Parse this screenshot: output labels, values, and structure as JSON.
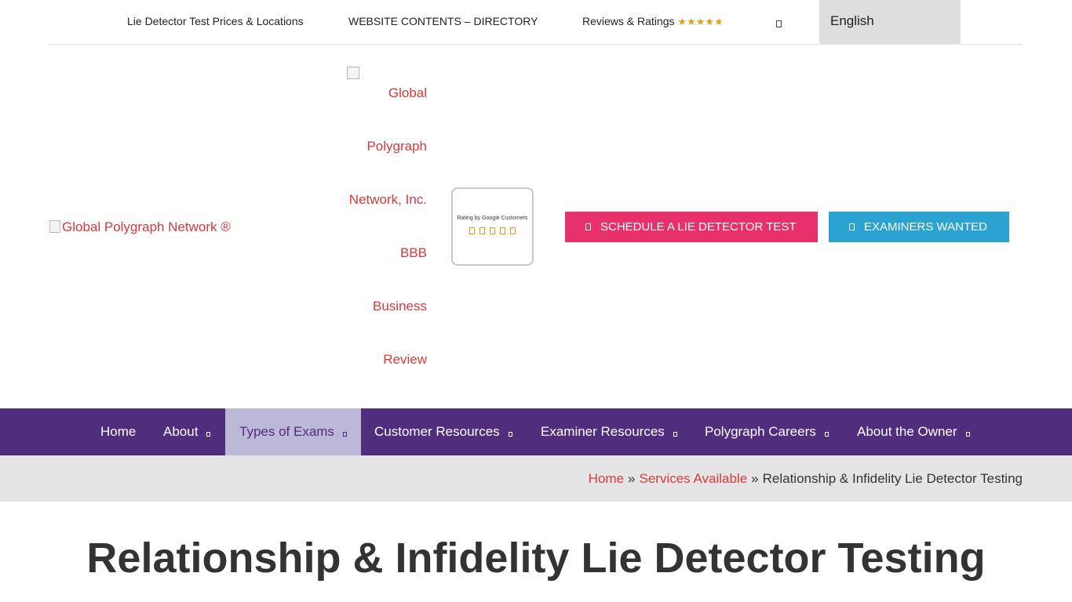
{
  "topbar": {
    "link_prices": "Lie Detector Test Prices & Locations",
    "link_directory": "WEBSITE CONTENTS – DIRECTORY",
    "link_reviews": "Reviews & Ratings",
    "reviews_stars": "★★★★★",
    "icon": "search-icon",
    "language": "English"
  },
  "header": {
    "logo_alt": "Global Polygraph Network ®",
    "bbb_lines": [
      "Global",
      "Polygraph",
      "Network, Inc.",
      "BBB",
      "Business",
      "Review"
    ],
    "rating_badge_text": "Rating by Google Customers",
    "rating_stars": 5,
    "schedule_button": "SCHEDULE A LIE DETECTOR TEST",
    "examiners_button": "EXAMINERS WANTED",
    "schedule_color": "#e8316a",
    "examiners_color": "#2aa3d3"
  },
  "nav": {
    "background": "#512d7d",
    "items": [
      {
        "label": "Home"
      },
      {
        "label": "About"
      },
      {
        "label": "Types of Exams"
      },
      {
        "label": "Customer Resources"
      },
      {
        "label": "Examiner Resources"
      },
      {
        "label": "Polygraph Careers"
      },
      {
        "label": "About the Owner"
      }
    ],
    "active_item": "Types of Exams"
  },
  "breadcrumb": {
    "home": "Home",
    "separator": "»",
    "services": "Services Available",
    "current": "Relationship & Infidelity Lie Detector Testing"
  },
  "page": {
    "title": "Relationship & Infidelity Lie Detector Testing"
  }
}
